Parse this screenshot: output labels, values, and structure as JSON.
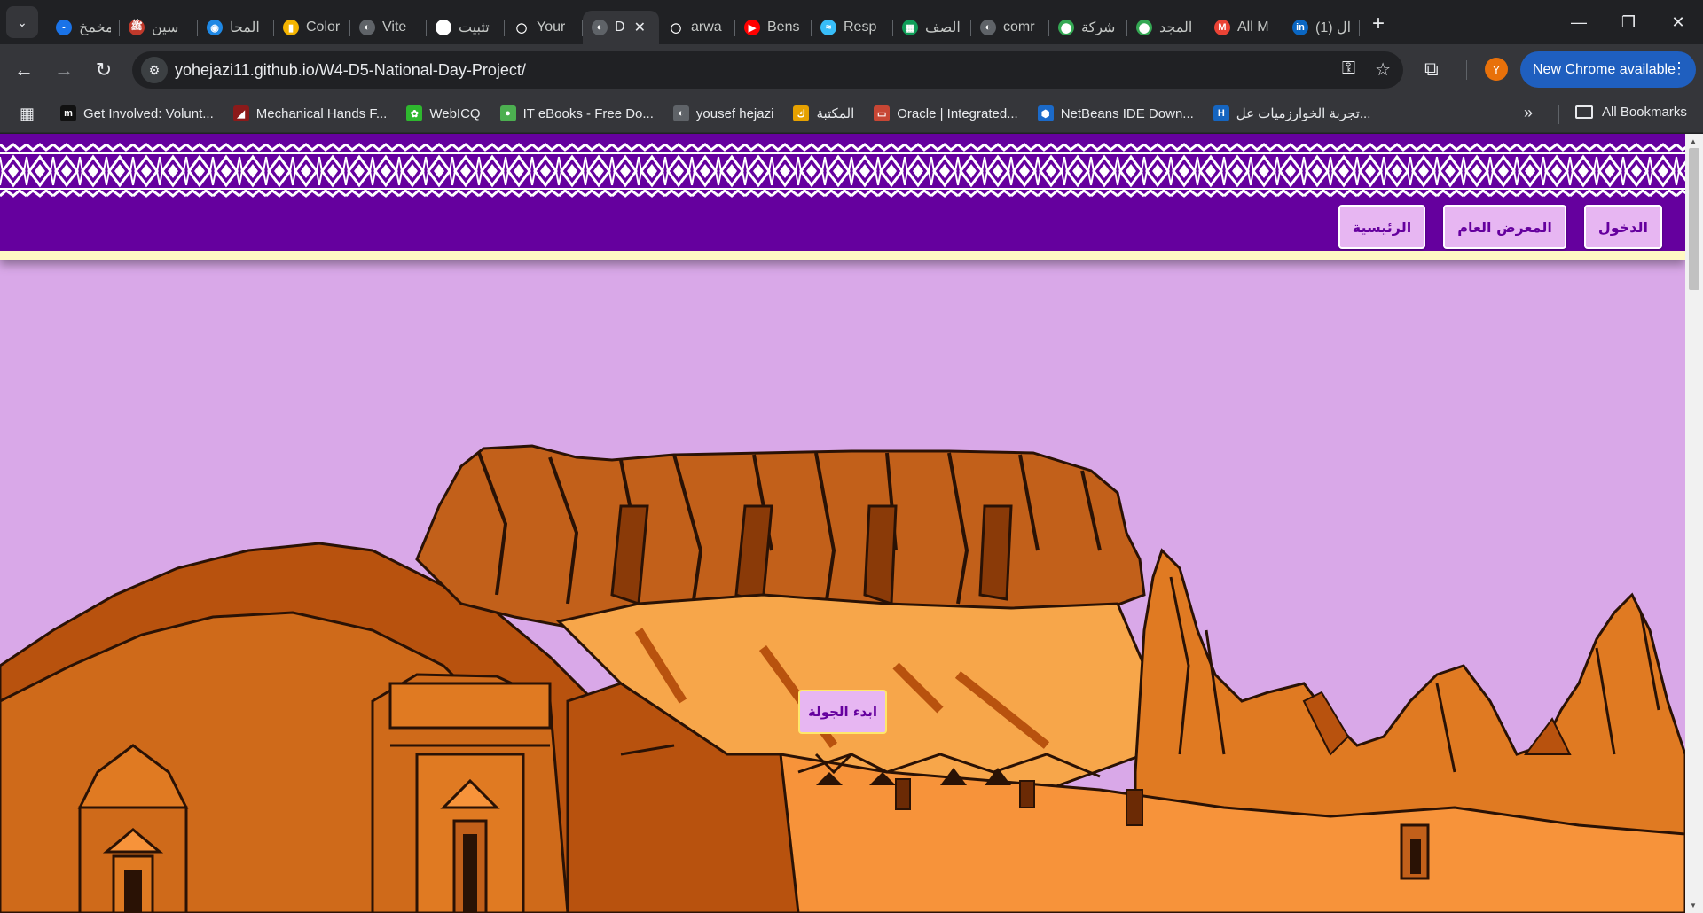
{
  "browser": {
    "tabs": [
      {
        "label": "مخمخ",
        "fav_color": "#1a73e8",
        "fav_glyph": "-"
      },
      {
        "label": "سين",
        "fav_color": "#c0392b",
        "fav_glyph": "ﷺ"
      },
      {
        "label": "المحا",
        "fav_color": "#1e88e5",
        "fav_glyph": "◉"
      },
      {
        "label": "Color",
        "fav_color": "#f4b400",
        "fav_glyph": "▮"
      },
      {
        "label": "Vite",
        "fav_color": "#5f6368",
        "fav_glyph": "◐"
      },
      {
        "label": "تثبيت",
        "fav_color": "#ffffff",
        "fav_glyph": "✿"
      },
      {
        "label": "Your",
        "fav_color": "#202124",
        "fav_glyph": "◯"
      },
      {
        "label": "D",
        "fav_color": "#5f6368",
        "fav_glyph": "◐",
        "active": true
      },
      {
        "label": "arwa",
        "fav_color": "#202124",
        "fav_glyph": "◯"
      },
      {
        "label": "Bens",
        "fav_color": "#ff0000",
        "fav_glyph": "▶"
      },
      {
        "label": "Resp",
        "fav_color": "#38bdf8",
        "fav_glyph": "≈"
      },
      {
        "label": "الصف",
        "fav_color": "#0f9d58",
        "fav_glyph": "▦"
      },
      {
        "label": "comr",
        "fav_color": "#5f6368",
        "fav_glyph": "◐"
      },
      {
        "label": "شركة",
        "fav_color": "#34a853",
        "fav_glyph": "⬤"
      },
      {
        "label": "المجد",
        "fav_color": "#34a853",
        "fav_glyph": "⬤"
      },
      {
        "label": "All M",
        "fav_color": "#ea4335",
        "fav_glyph": "M"
      },
      {
        "label": "(1) ال",
        "fav_color": "#0a66c2",
        "fav_glyph": "in"
      }
    ],
    "tab_search_icon": "chevron-down-icon",
    "new_tab_glyph": "+",
    "window_controls": {
      "minimize": "—",
      "maximize": "❐",
      "close": "✕"
    },
    "address_url": "yohejazi11.github.io/W4-D5-National-Day-Project/",
    "profile_initial": "Y",
    "update_label": "New Chrome available",
    "bookmarks": [
      {
        "label": "Get Involved: Volunt...",
        "fav_color": "#111111",
        "fav_glyph": "m"
      },
      {
        "label": "Mechanical Hands F...",
        "fav_color": "#8b1a1a",
        "fav_glyph": "◢"
      },
      {
        "label": "WebICQ",
        "fav_color": "#2eb82e",
        "fav_glyph": "✿"
      },
      {
        "label": "IT eBooks - Free Do...",
        "fav_color": "#4caf50",
        "fav_glyph": "●"
      },
      {
        "label": "yousef hejazi",
        "fav_color": "#5f6368",
        "fav_glyph": "◐"
      },
      {
        "label": "المكتبة",
        "fav_color": "#e6a100",
        "fav_glyph": "ك"
      },
      {
        "label": "Oracle | Integrated...",
        "fav_color": "#c74634",
        "fav_glyph": "▭"
      },
      {
        "label": "NetBeans IDE Down...",
        "fav_color": "#1b6ac9",
        "fav_glyph": "⬢"
      },
      {
        "label": "تجربة الخوارزميات عل...",
        "fav_color": "#1565c0",
        "fav_glyph": "H"
      }
    ],
    "more_bookmarks_glyph": "»",
    "all_bookmarks_label": "All Bookmarks"
  },
  "site": {
    "nav": [
      {
        "label": "الدخول",
        "name": "login-button"
      },
      {
        "label": "المعرض العام",
        "name": "gallery-button"
      },
      {
        "label": "الرئيسية",
        "name": "home-button"
      }
    ],
    "start_tour_label": "ابدء الجولة",
    "colors": {
      "header_purple": "#65009e",
      "page_lavender": "#d9a8e8",
      "button_fill": "#e7b6f2",
      "rock_light": "#f7933a",
      "rock_mid": "#e07a22",
      "rock_dark": "#b8520e"
    }
  }
}
